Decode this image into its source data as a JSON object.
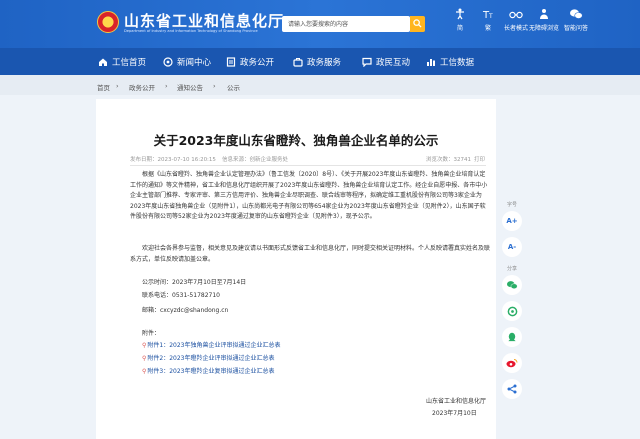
{
  "header": {
    "site_title": "山东省工业和信息化厅",
    "site_subtitle": "Department of Industry and Information Technology of Shandong Province",
    "search_placeholder": "请输入您要搜索的内容",
    "tools": [
      {
        "icon": "accessibility-icon",
        "label": "简"
      },
      {
        "icon": "font-size-icon",
        "label": "繁"
      },
      {
        "icon": "glasses-icon",
        "label": "长者模式"
      },
      {
        "icon": "person-icon",
        "label": "无障碍浏览"
      },
      {
        "icon": "wechat-icon",
        "label": "智能问答"
      }
    ]
  },
  "nav": [
    {
      "icon": "home-icon",
      "label": "工信首页"
    },
    {
      "icon": "news-icon",
      "label": "新闻中心"
    },
    {
      "icon": "document-icon",
      "label": "政务公开"
    },
    {
      "icon": "service-icon",
      "label": "政务服务"
    },
    {
      "icon": "chat-icon",
      "label": "政民互动"
    },
    {
      "icon": "data-icon",
      "label": "工信数据"
    }
  ],
  "breadcrumb": [
    "首页",
    "政务公开",
    "通知公告",
    "公示"
  ],
  "article": {
    "title": "关于2023年度山东省瞪羚、独角兽企业名单的公示",
    "date": "发布日期：2023-07-10 16:20:15",
    "source": "信息来源：创新企业服务处",
    "views": "浏览次数：32741",
    "print": "打印",
    "para1": "根据《山东省瞪羚、独角兽企业认定管理办法》（鲁工信发〔2020〕8号）、《关于开展2023年度山东省瞪羚、独角兽企业培育认定工作的通知》等文件精神，省工业和信息化厅组织开展了2023年度山东省瞪羚、独角兽企业培育认定工作。经企业自愿申报、各市中小企业主管部门推荐、专家评审、第三方信用评价、独角兽企业尽职调查、联合线审等程序，拟确定维工重机股份有限公司等3家企业为2023年度山东省独角兽企业（见附件1），山东尚都光电子有限公司等654家企业为2023年度山东省瞪羚企业（见附件2），山东国子软件股份有限公司等52家企业为2023年度通过复审的山东省瞪羚企业（见附件3），现予公示。",
    "para2": "欢迎社会各界参与监督，相关意见及建议请以书面形式反馈省工业和信息化厅，同时提交相关证明材料。个人反映请署真实姓名及联系方式，单位反映请加盖公章。",
    "period": "公示时间：2023年7月10日至7月14日",
    "phone": "联系电话：0531-51782710",
    "email": "邮箱：cxcyzdc@shandong.cn",
    "attachments_label": "附件：",
    "attachments": [
      "附件1：2023年独角兽企业评审拟通过企业汇总表",
      "附件2：2023年瞪羚企业评审拟通过企业汇总表",
      "附件3：2023年瞪羚企业复审拟通过企业汇总表"
    ],
    "signature_org": "山东省工业和信息化厅",
    "signature_date": "2023年7月10日"
  },
  "sidebar": {
    "font_label": "字号",
    "share_label": "分享",
    "font_buttons": [
      "A+",
      "A-"
    ]
  },
  "colors": {
    "header_blue": "#2b6fd1",
    "nav_blue": "#1a56b0",
    "accent": "#ffb51f"
  }
}
